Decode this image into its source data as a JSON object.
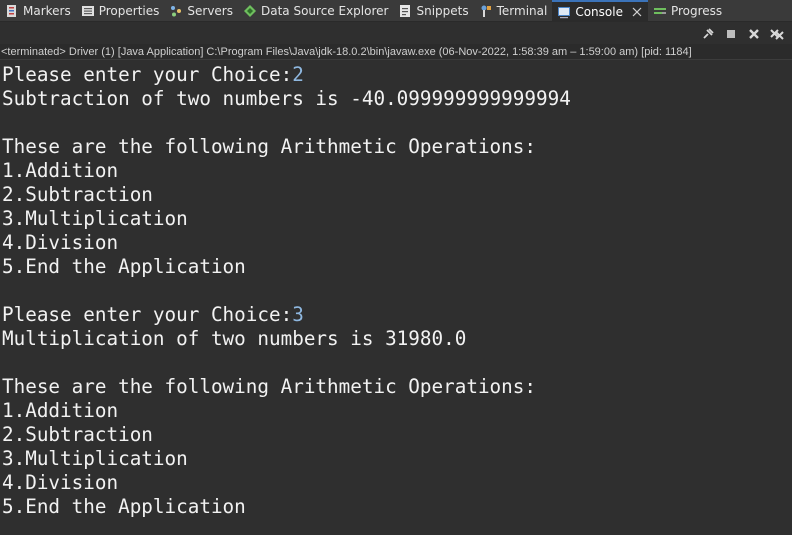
{
  "tabs": [
    {
      "label": "Markers",
      "icon": "markers-icon"
    },
    {
      "label": "Properties",
      "icon": "properties-icon"
    },
    {
      "label": "Servers",
      "icon": "servers-icon"
    },
    {
      "label": "Data Source Explorer",
      "icon": "data-source-explorer-icon"
    },
    {
      "label": "Snippets",
      "icon": "snippets-icon"
    },
    {
      "label": "Terminal",
      "icon": "terminal-icon"
    },
    {
      "label": "Console",
      "icon": "console-icon",
      "active": true
    },
    {
      "label": "Progress",
      "icon": "progress-icon"
    }
  ],
  "toolbar": {
    "buttons": [
      "pin-console-icon",
      "terminate-icon",
      "remove-launch-icon",
      "remove-all-terminated-icon"
    ]
  },
  "console": {
    "description": "<terminated> Driver (1) [Java Application] C:\\Program Files\\Java\\jdk-18.0.2\\bin\\javaw.exe  (06-Nov-2022, 1:58:39 am – 1:59:00 am) [pid: 1184]",
    "lines": [
      {
        "text": "Please enter your Choice:",
        "input": "2"
      },
      {
        "text": "Subtraction of two numbers is -40.099999999999994"
      },
      {
        "text": ""
      },
      {
        "text": "These are the following Arithmetic Operations:"
      },
      {
        "text": "1.Addition"
      },
      {
        "text": "2.Subtraction"
      },
      {
        "text": "3.Multiplication"
      },
      {
        "text": "4.Division"
      },
      {
        "text": "5.End the Application"
      },
      {
        "text": ""
      },
      {
        "text": "Please enter your Choice:",
        "input": "3"
      },
      {
        "text": "Multiplication of two numbers is 31980.0"
      },
      {
        "text": ""
      },
      {
        "text": "These are the following Arithmetic Operations:"
      },
      {
        "text": "1.Addition"
      },
      {
        "text": "2.Subtraction"
      },
      {
        "text": "3.Multiplication"
      },
      {
        "text": "4.Division"
      },
      {
        "text": "5.End the Application"
      }
    ]
  },
  "colors": {
    "background": "#2f2f2f",
    "console_text": "#f2f2f2",
    "user_input": "#8fb8e0",
    "active_tab_accent": "#3b73b9"
  }
}
